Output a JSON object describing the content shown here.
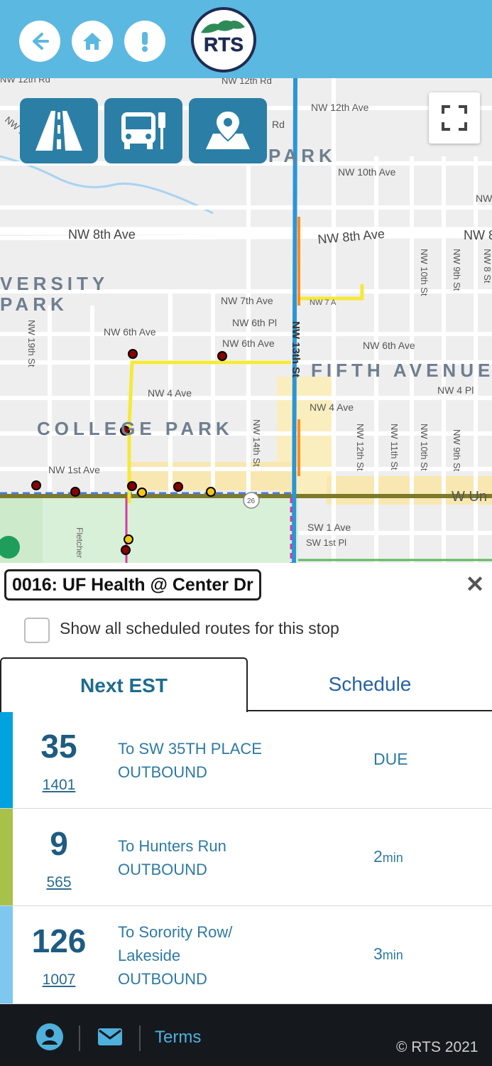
{
  "header": {
    "back_icon": "arrow-left-icon",
    "home_icon": "home-icon",
    "alert_icon": "exclamation-icon",
    "logo_text": "RTS",
    "bg_color": "#5bb8e0"
  },
  "map": {
    "buttons": [
      {
        "icon": "road-icon"
      },
      {
        "icon": "bus-stop-icon"
      },
      {
        "icon": "map-pin-icon"
      }
    ],
    "fullscreen_icon": "fullscreen-icon",
    "labels": {
      "nw12rd": "NW 12th Rd",
      "nw12ave": "NW 12th Ave",
      "rd": "Rd",
      "park_top": "PARK",
      "nw10ave": "NW 10th Ave",
      "nw8ave_left": "NW 8th Ave",
      "nw8ave_right": "NW 8th Ave",
      "nw_right1": "NW",
      "nw_right2": "NW 8",
      "versity": "VERSITY",
      "park_left": "PARK",
      "nw7ave": "NW 7th Ave",
      "nw7a": "NW 7 A",
      "nw6pl": "NW 6th Pl",
      "nw6ave_left": "NW 6th Ave",
      "nw6ave_mid": "NW 6th Ave",
      "nw6ave_right": "NW 6th Ave",
      "nw4ave_left": "NW 4 Ave",
      "nw4ave_right": "NW 4 Ave",
      "nw4pl": "NW 4 Pl",
      "fifth_avenue": "FIFTH AVENUE",
      "college_park": "COLLEGE PARK",
      "nw1ave": "NW 1st Ave",
      "nw19st": "NW 19th St",
      "nw14st": "NW 14th St",
      "nw13st": "NW 13th St",
      "nw12st": "NW 12th St",
      "nw11st": "NW 11th St",
      "nw10st_top": "NW 10th St",
      "nw10st_bottom": "NW 10th St",
      "nw9st_top": "NW 9th St",
      "nw9st_bottom": "NW 9th St",
      "nw8st": "NW 8 St",
      "sw1ave": "SW 1 Ave",
      "sw1pl": "SW 1st Pl",
      "w_univ": "W Un",
      "route26": "26",
      "fletcher": "Fletcher",
      "nw12": "NW 12"
    }
  },
  "stop": {
    "title": "0016: UF Health @ Center Dr",
    "close_label": "✕",
    "show_all_label": "Show all scheduled routes for this stop"
  },
  "tabs": [
    {
      "label": "Next EST",
      "active": true
    },
    {
      "label": "Schedule",
      "active": false
    }
  ],
  "arrivals": [
    {
      "route": "35",
      "vehicle": "1401",
      "dest_lines": [
        "To SW 35TH PLACE",
        "OUTBOUND"
      ],
      "eta_value": "DUE",
      "eta_unit": "",
      "color": "#00a3e0"
    },
    {
      "route": "9",
      "vehicle": "565",
      "dest_lines": [
        "To Hunters Run",
        "OUTBOUND"
      ],
      "eta_value": "2",
      "eta_unit": "min",
      "color": "#a8c14a"
    },
    {
      "route": "126",
      "vehicle": "1007",
      "dest_lines": [
        "To Sorority Row/",
        "Lakeside",
        "OUTBOUND"
      ],
      "eta_value": "3",
      "eta_unit": "min",
      "color": "#7ec8f0"
    }
  ],
  "footer": {
    "user_icon": "user-icon",
    "mail_icon": "mail-icon",
    "terms_label": "Terms",
    "copyright": "© RTS 2021"
  }
}
